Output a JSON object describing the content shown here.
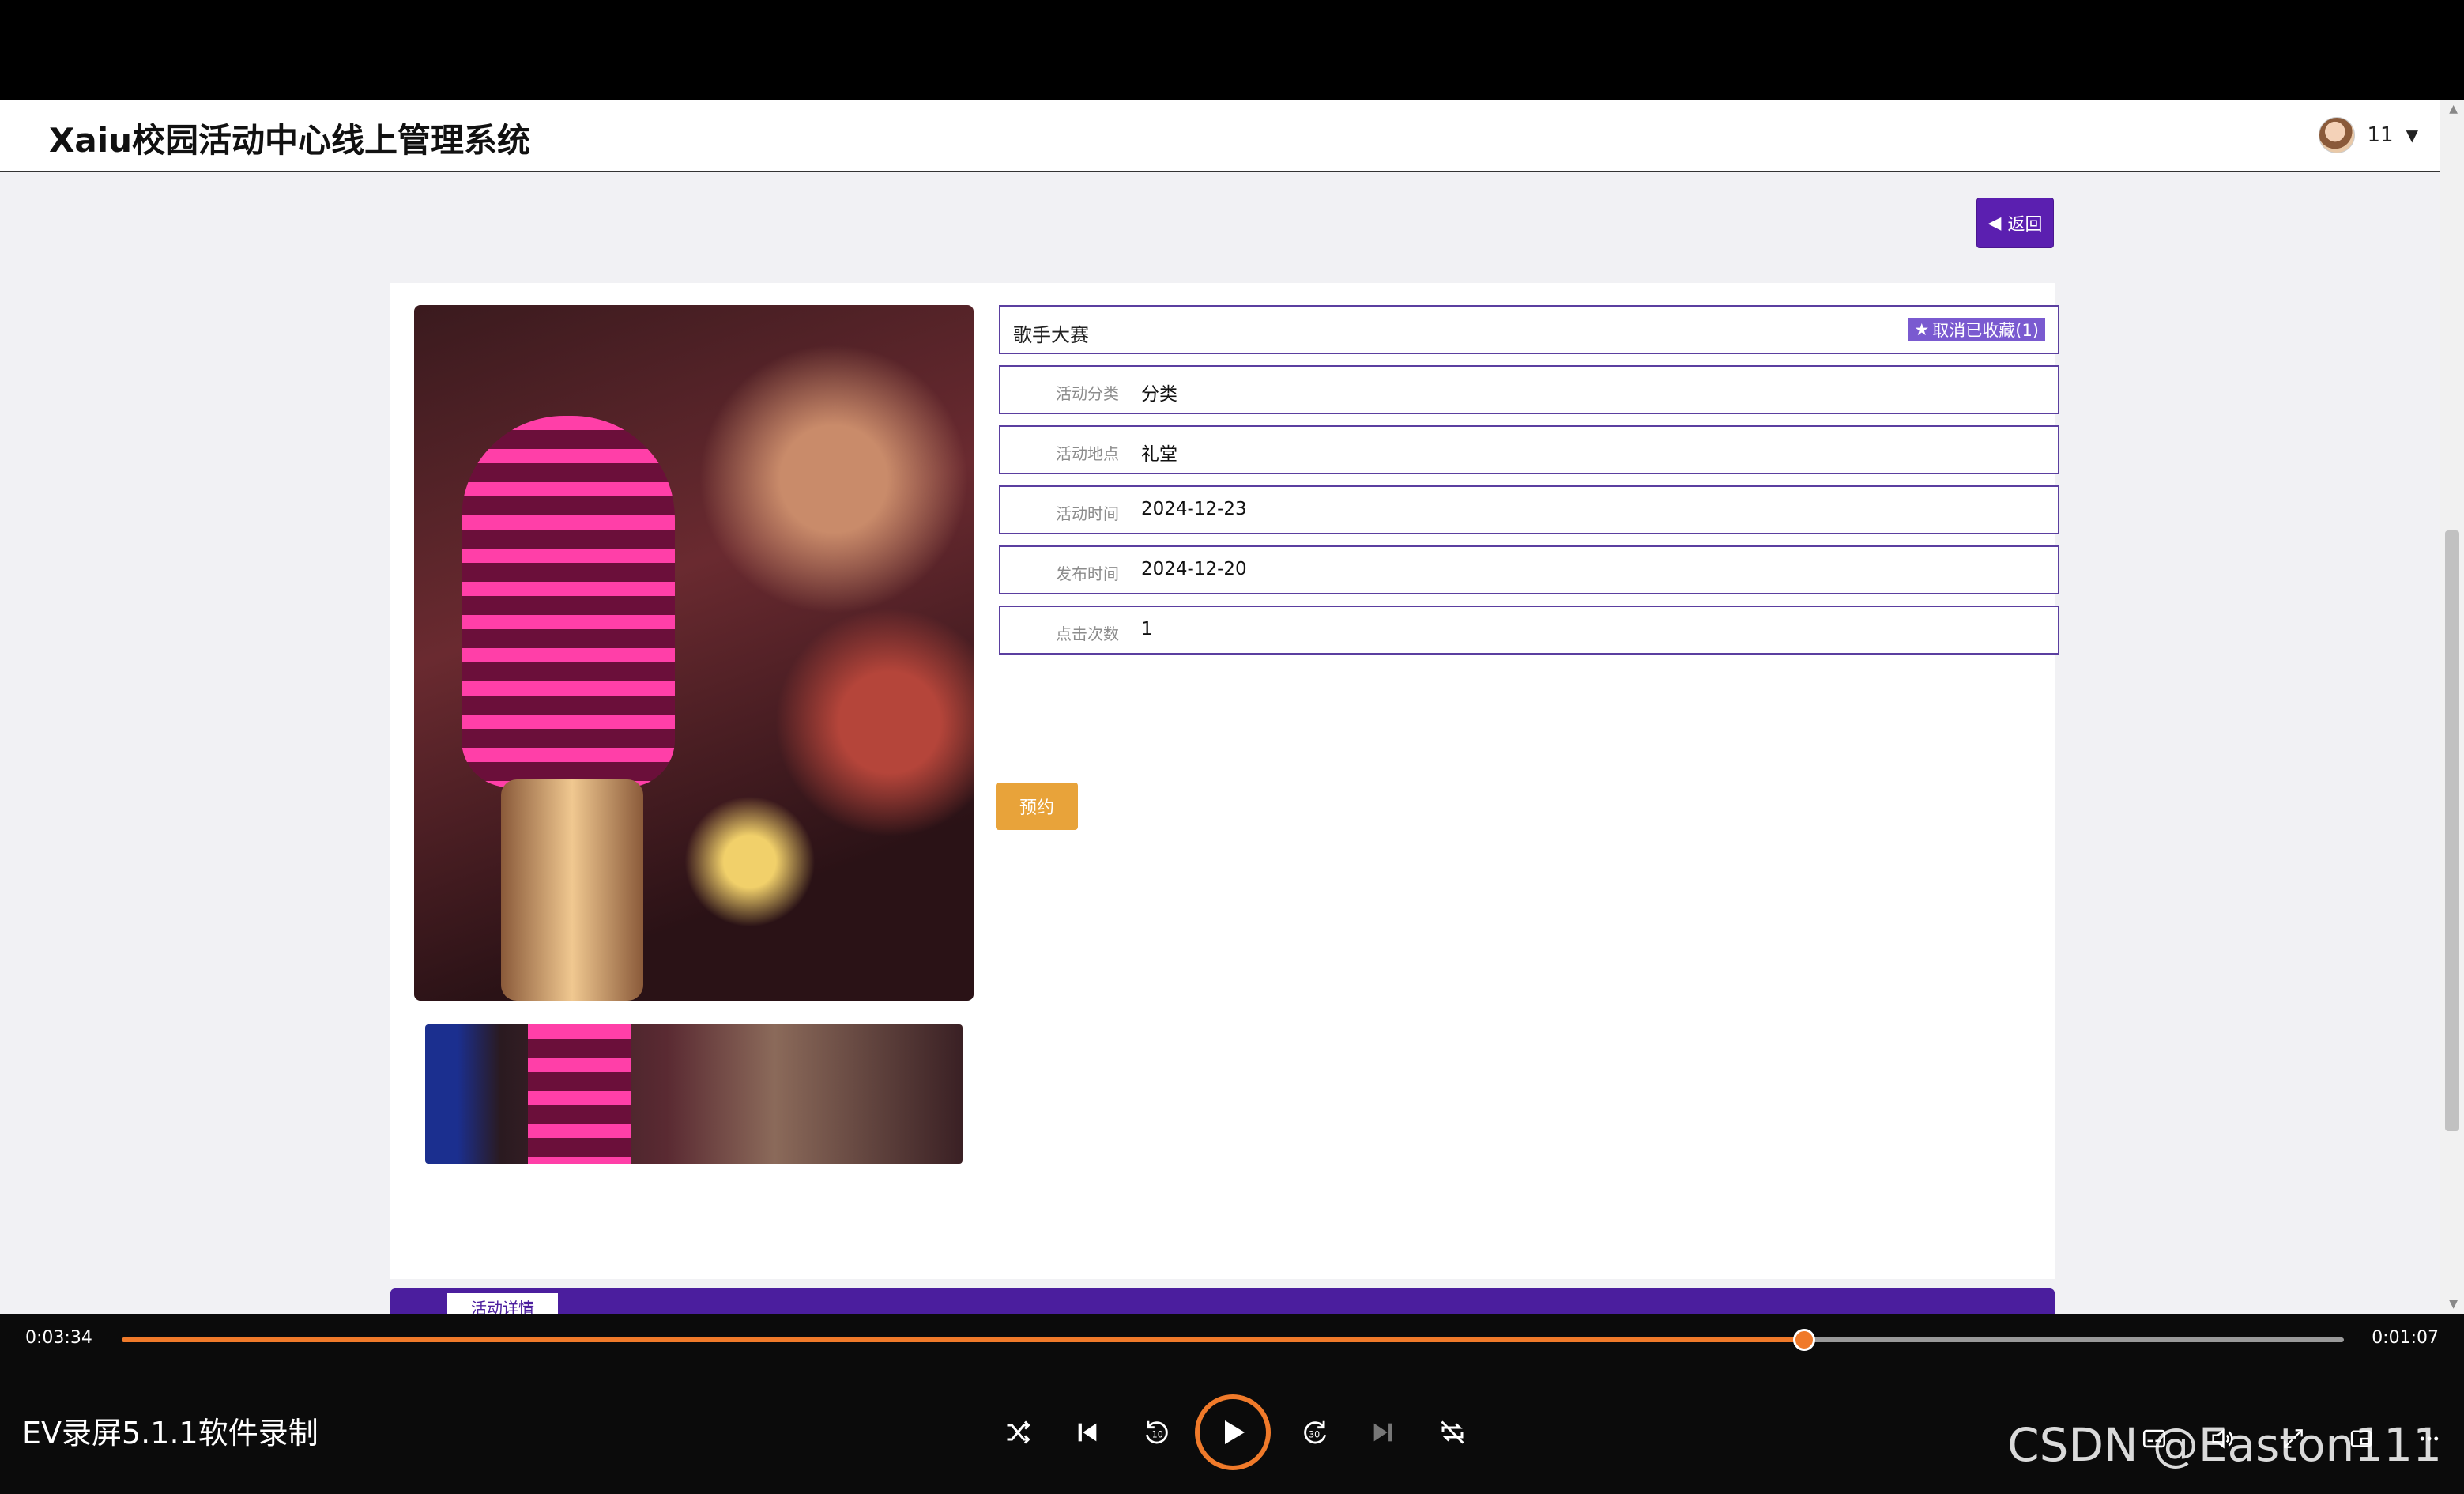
{
  "page": {
    "site_title": "Xaiu校园活动中心线上管理系统",
    "username": "11",
    "back_label": "返回"
  },
  "activity": {
    "name": "歌手大赛",
    "favorite_label": "取消已收藏(1)",
    "fields": [
      {
        "label": "活动分类",
        "value": "分类"
      },
      {
        "label": "活动地点",
        "value": "礼堂"
      },
      {
        "label": "活动时间",
        "value": "2024-12-23"
      },
      {
        "label": "发布时间",
        "value": "2024-12-20"
      },
      {
        "label": "点击次数",
        "value": "1"
      }
    ],
    "reserve_label": "预约",
    "tab_label": "活动详情"
  },
  "player": {
    "time_current": "0:03:34",
    "time_total": "0:01:07",
    "progress_fraction": 0.757,
    "recorder_label": "EV录屏5.1.1软件录制",
    "watermark": "CSDN @Easton111",
    "accent_color": "#f07a2a"
  },
  "icons": [
    "shuffle-icon",
    "previous-icon",
    "rewind-10-icon",
    "play-icon",
    "forward-30-icon",
    "next-icon",
    "repeat-off-icon",
    "subtitles-icon",
    "volume-icon",
    "fullscreen-icon",
    "mini-player-icon",
    "more-icon"
  ]
}
